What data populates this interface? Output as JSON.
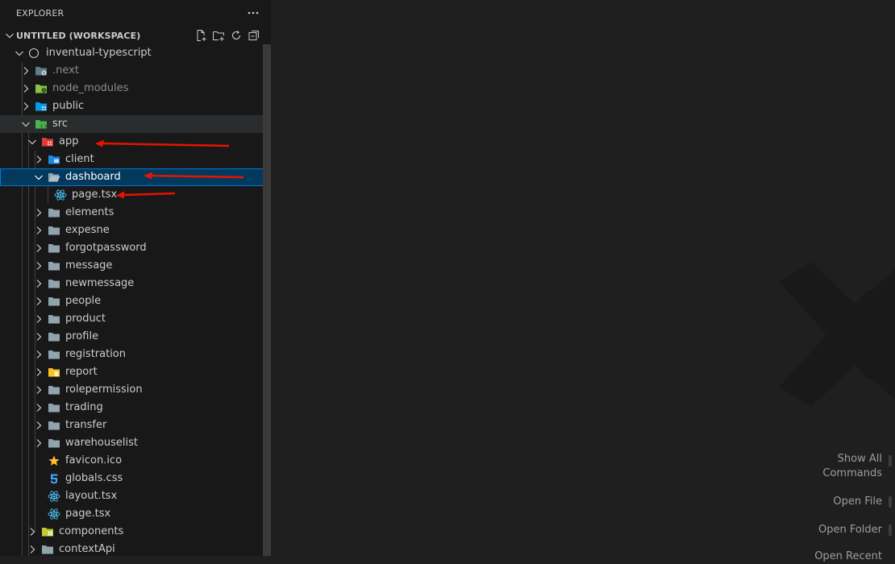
{
  "explorer": {
    "title": "EXPLORER",
    "more_icon": "ellipsis-icon",
    "workspace": {
      "title": "UNTITLED (WORKSPACE)",
      "actions": [
        "new-file-icon",
        "new-folder-icon",
        "refresh-icon",
        "collapse-all-icon"
      ]
    },
    "tree": [
      {
        "label": "inventual-typescript",
        "icon": "root-folder-icon",
        "expanded": true
      },
      {
        "label": ".next",
        "icon": "next-folder-icon",
        "expanded": false
      },
      {
        "label": "node_modules",
        "icon": "node-folder-icon",
        "expanded": false
      },
      {
        "label": "public",
        "icon": "public-folder-icon",
        "expanded": false
      },
      {
        "label": "src",
        "icon": "src-folder-icon",
        "expanded": true
      },
      {
        "label": "app",
        "icon": "app-folder-icon",
        "expanded": true
      },
      {
        "label": "client",
        "icon": "client-folder-icon",
        "expanded": false
      },
      {
        "label": "dashboard",
        "icon": "folder-open-icon",
        "expanded": true,
        "selected": true
      },
      {
        "label": "page.tsx",
        "icon": "react-icon"
      },
      {
        "label": "elements",
        "icon": "folder-icon",
        "expanded": false
      },
      {
        "label": "expesne",
        "icon": "folder-icon",
        "expanded": false
      },
      {
        "label": "forgotpassword",
        "icon": "folder-icon",
        "expanded": false
      },
      {
        "label": "message",
        "icon": "folder-icon",
        "expanded": false
      },
      {
        "label": "newmessage",
        "icon": "folder-icon",
        "expanded": false
      },
      {
        "label": "people",
        "icon": "folder-icon",
        "expanded": false
      },
      {
        "label": "product",
        "icon": "folder-icon",
        "expanded": false
      },
      {
        "label": "profile",
        "icon": "folder-icon",
        "expanded": false
      },
      {
        "label": "registration",
        "icon": "folder-icon",
        "expanded": false
      },
      {
        "label": "report",
        "icon": "report-folder-icon",
        "expanded": false
      },
      {
        "label": "rolepermission",
        "icon": "folder-icon",
        "expanded": false
      },
      {
        "label": "trading",
        "icon": "folder-icon",
        "expanded": false
      },
      {
        "label": "transfer",
        "icon": "folder-icon",
        "expanded": false
      },
      {
        "label": "warehouselist",
        "icon": "folder-icon",
        "expanded": false
      },
      {
        "label": "favicon.ico",
        "icon": "star-icon"
      },
      {
        "label": "globals.css",
        "icon": "css-icon"
      },
      {
        "label": "layout.tsx",
        "icon": "react-icon"
      },
      {
        "label": "page.tsx",
        "icon": "react-icon"
      },
      {
        "label": "components",
        "icon": "components-folder-icon",
        "expanded": false
      },
      {
        "label": "contextApi",
        "icon": "folder-icon",
        "expanded": false
      }
    ]
  },
  "editor": {
    "watermark_icon": "vscode-logo-icon",
    "hints": [
      {
        "line1": "Show All",
        "line2": "Commands"
      },
      {
        "line1": "Open File"
      },
      {
        "line1": "Open Folder"
      },
      {
        "line1": "Open Recent"
      }
    ]
  },
  "colors": {
    "sidebar_bg": "#181818",
    "editor_bg": "#1f1f1f",
    "selection_bg": "#04395e",
    "selection_border": "#0078d4",
    "annotation_arrow": "#e51400"
  }
}
